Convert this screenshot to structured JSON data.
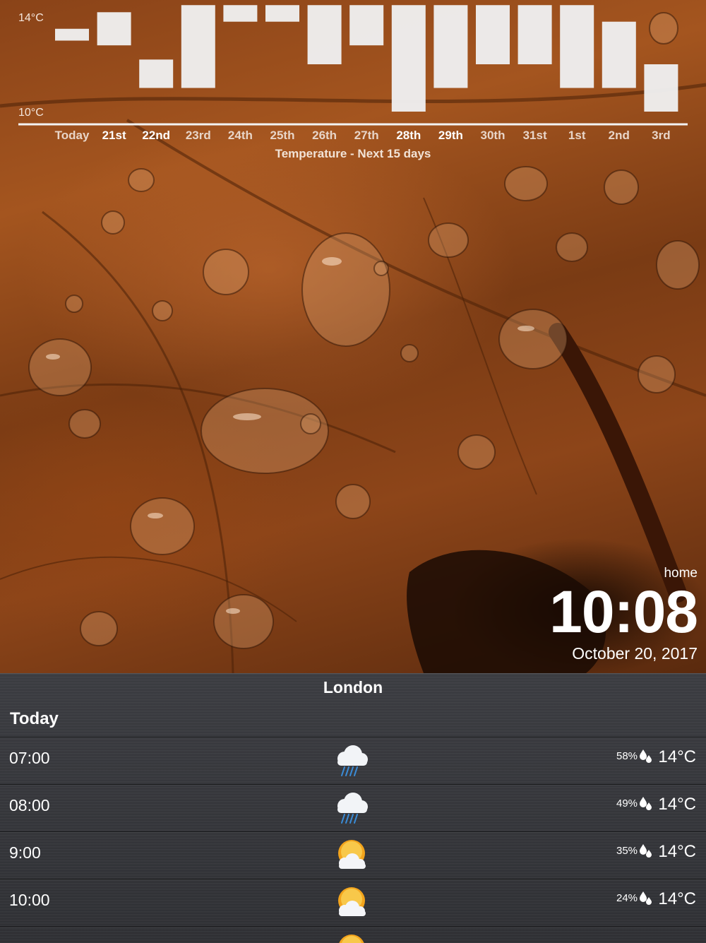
{
  "chart_data": {
    "type": "bar",
    "title": "Temperature - Next 15 days",
    "categories": [
      "Today",
      "21st",
      "22nd",
      "23rd",
      "24th",
      "25th",
      "26th",
      "27th",
      "28th",
      "29th",
      "30th",
      "31st",
      "1st",
      "2nd",
      "3rd"
    ],
    "series": [
      {
        "low": 13,
        "high": 13.5
      },
      {
        "low": 12.8,
        "high": 14.2
      },
      {
        "low": 11,
        "high": 12.2
      },
      {
        "low": 11,
        "high": 14.5
      },
      {
        "low": 13.8,
        "high": 14.5
      },
      {
        "low": 13.8,
        "high": 14.5
      },
      {
        "low": 12,
        "high": 14.5
      },
      {
        "low": 12.8,
        "high": 14.5
      },
      {
        "low": 10,
        "high": 14.5
      },
      {
        "low": 11,
        "high": 14.5
      },
      {
        "low": 12,
        "high": 14.5
      },
      {
        "low": 12,
        "high": 14.5
      },
      {
        "low": 11,
        "high": 14.5
      },
      {
        "low": 11,
        "high": 13.8
      },
      {
        "low": 10,
        "high": 12
      }
    ],
    "ylim": [
      10,
      14
    ],
    "ytick_labels": [
      "14°C",
      "10°C"
    ],
    "day_label_colors": [
      "#e8d5c8",
      "#ffffff",
      "#ffffff",
      "#e8d5c8",
      "#e8d5c8",
      "#e8d5c8",
      "#e8d5c8",
      "#e8d5c8",
      "#ffffff",
      "#ffffff",
      "#e8d5c8",
      "#e8d5c8",
      "#e8d5c8",
      "#e8d5c8",
      "#e8d5c8"
    ]
  },
  "clock": {
    "location": "home",
    "time": "10:08",
    "date": "October 20, 2017"
  },
  "forecast": {
    "city": "London",
    "day": "Today",
    "hours": [
      {
        "time": "07:00",
        "icon": "rain-cloud-icon",
        "precip": "58%",
        "temp": "14°C"
      },
      {
        "time": "08:00",
        "icon": "rain-cloud-icon",
        "precip": "49%",
        "temp": "14°C"
      },
      {
        "time": "9:00",
        "icon": "sun-cloud-icon",
        "precip": "35%",
        "temp": "14°C"
      },
      {
        "time": "10:00",
        "icon": "sun-cloud-icon",
        "precip": "24%",
        "temp": "14°C"
      }
    ]
  }
}
